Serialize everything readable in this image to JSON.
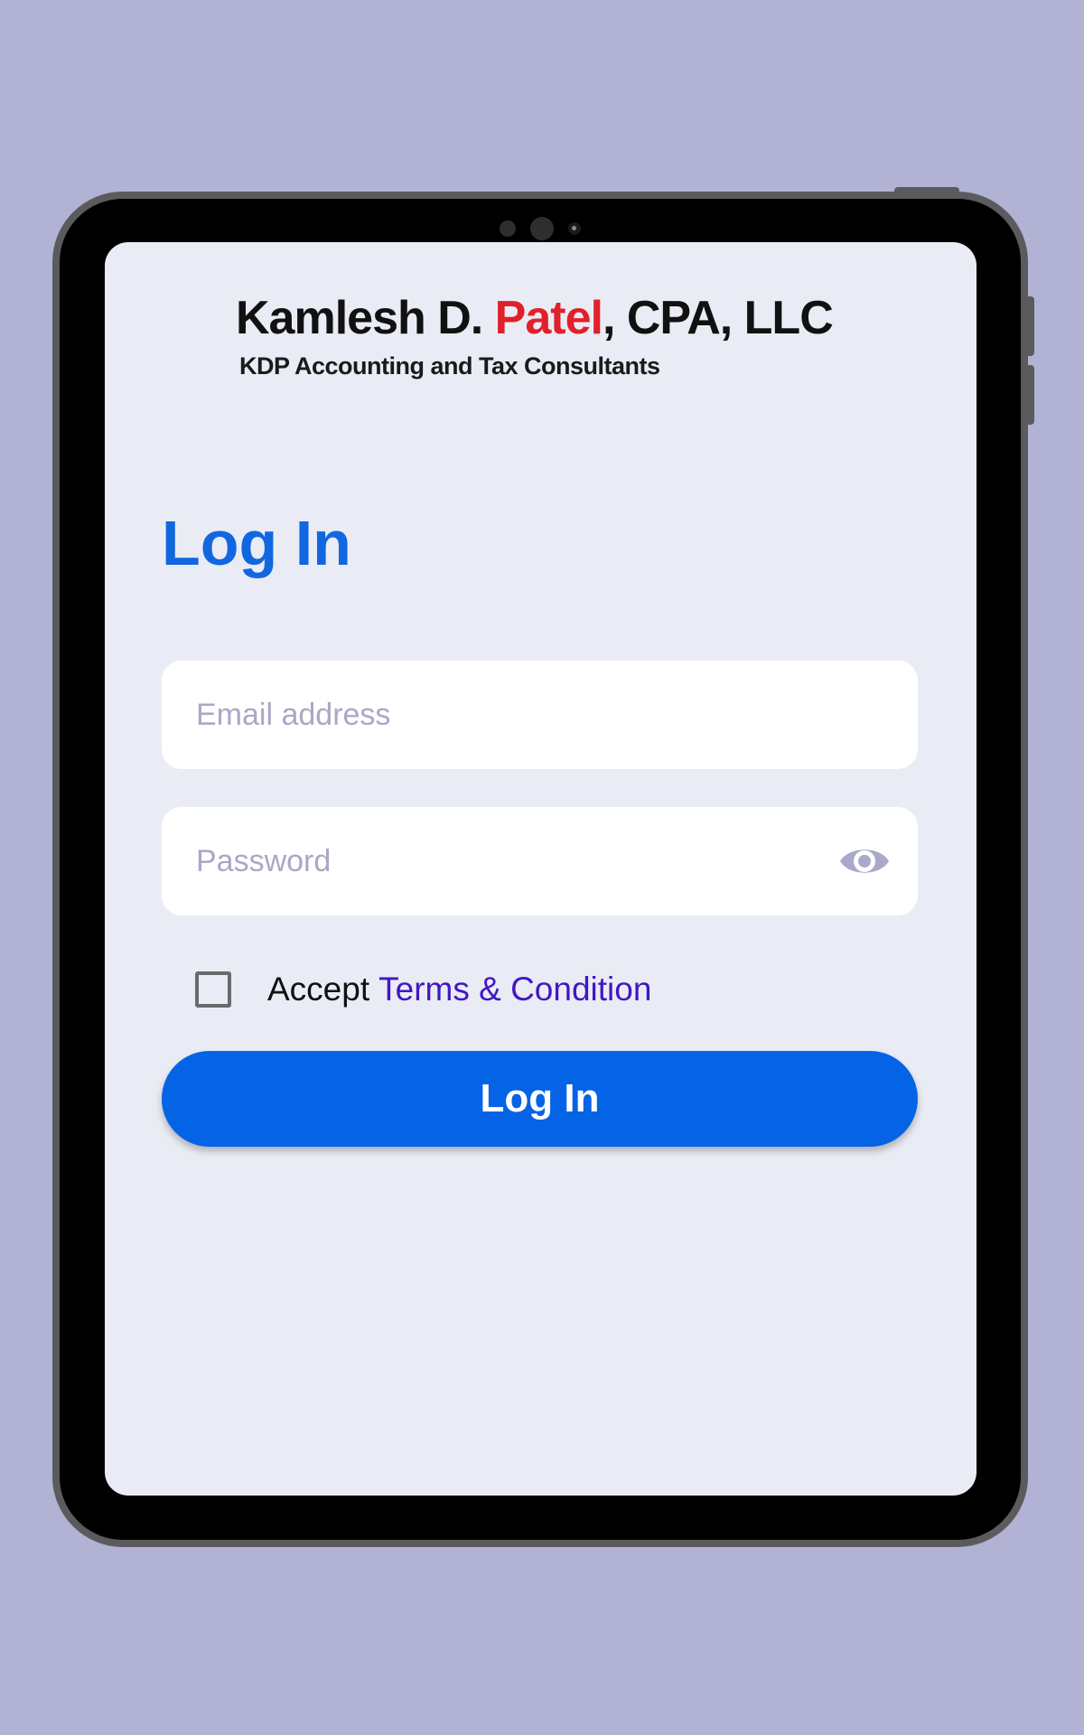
{
  "brand": {
    "name_part1": "Kamlesh D. ",
    "name_highlight": "Patel",
    "name_part2": ", CPA, LLC",
    "tagline": "KDP Accounting and Tax Consultants",
    "highlight_color": "#e0202a"
  },
  "login": {
    "heading": "Log In",
    "email_placeholder": "Email address",
    "password_placeholder": "Password",
    "password_toggle_icon": "eye-icon",
    "accept_label": "Accept",
    "terms_link": "Terms & Condition",
    "submit_label": "Log In"
  },
  "colors": {
    "background": "#b1b2d4",
    "screen": "#eaecf5",
    "primary": "#0563e6",
    "heading": "#1267e0",
    "link": "#4216c6"
  }
}
